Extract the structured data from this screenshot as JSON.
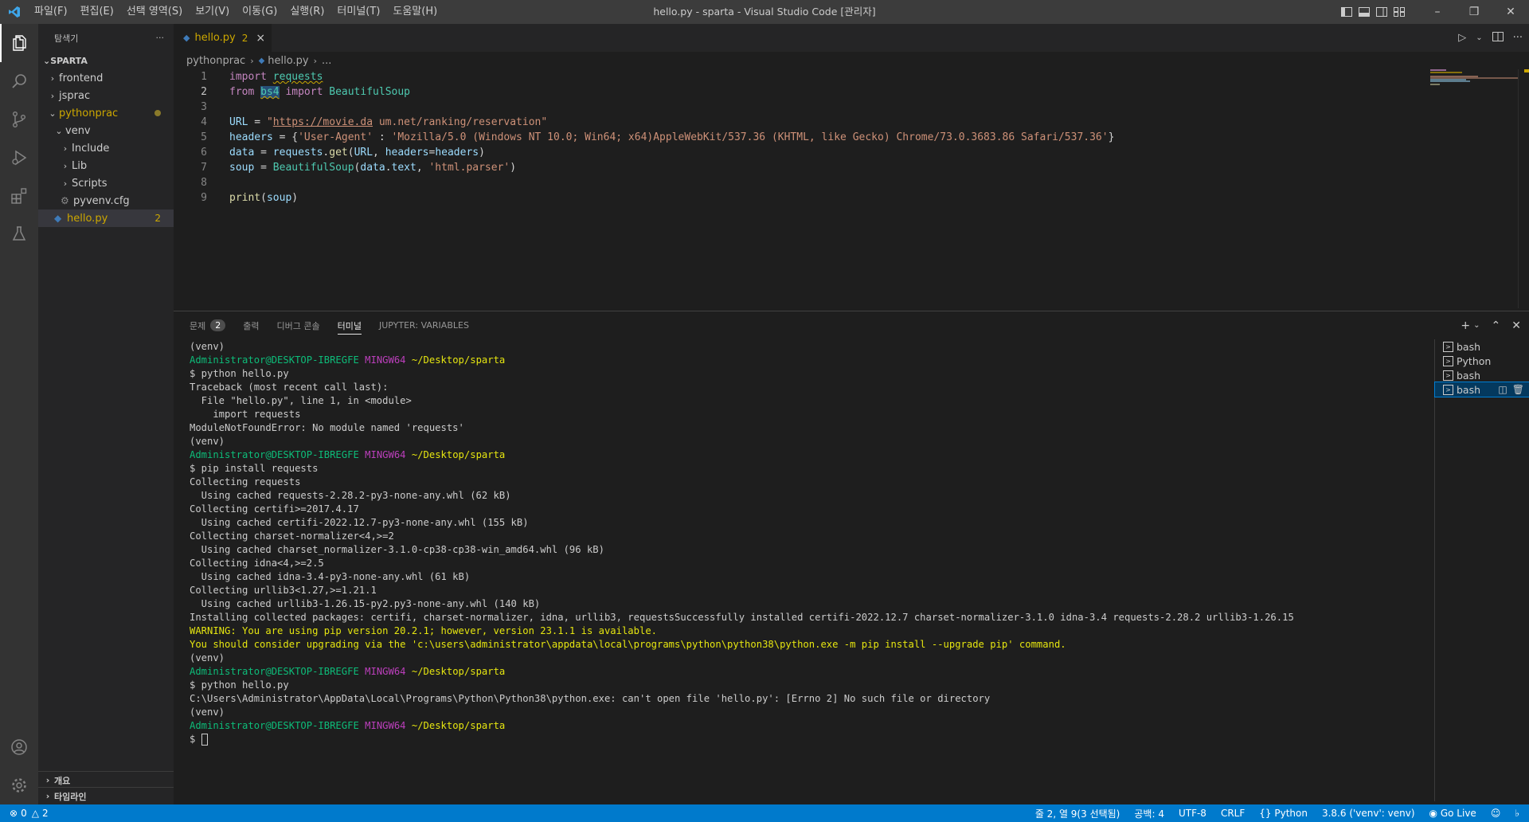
{
  "window": {
    "title": "hello.py - sparta - Visual Studio Code [관리자]",
    "menu": [
      "파일(F)",
      "편집(E)",
      "선택 영역(S)",
      "보기(V)",
      "이동(G)",
      "실행(R)",
      "터미널(T)",
      "도움말(H)"
    ]
  },
  "explorer": {
    "header": "탐색기",
    "more": "···",
    "root": "SPARTA",
    "items": [
      {
        "label": "frontend"
      },
      {
        "label": "jsprac"
      },
      {
        "label": "pythonprac"
      },
      {
        "label": "venv"
      },
      {
        "label": "Include"
      },
      {
        "label": "Lib"
      },
      {
        "label": "Scripts"
      },
      {
        "label": "pyvenv.cfg"
      },
      {
        "label": "hello.py",
        "badge": "2"
      }
    ],
    "outline": "개요",
    "timeline": "타임라인"
  },
  "editor": {
    "tab": {
      "label": "hello.py",
      "count": "2",
      "close": "×"
    },
    "breadcrumb": [
      "pythonprac",
      "hello.py",
      "..."
    ],
    "line_numbers": [
      "1",
      "2",
      "3",
      "4",
      "5",
      "6",
      "7",
      "8",
      "9"
    ]
  },
  "panel": {
    "tabs": [
      {
        "label": "문제",
        "count": "2"
      },
      {
        "label": "출력"
      },
      {
        "label": "디버그 콘솔"
      },
      {
        "label": "터미널"
      },
      {
        "label": "JUPYTER: VARIABLES"
      }
    ],
    "terminal_lines": [
      {
        "t": "(venv)"
      },
      {
        "prompt": true
      },
      {
        "t": "$ python hello.py"
      },
      {
        "t": "Traceback (most recent call last):"
      },
      {
        "t": "  File \"hello.py\", line 1, in <module>"
      },
      {
        "t": "    import requests"
      },
      {
        "t": "ModuleNotFoundError: No module named 'requests'"
      },
      {
        "t": "(venv)"
      },
      {
        "prompt": true
      },
      {
        "t": "$ pip install requests"
      },
      {
        "t": "Collecting requests"
      },
      {
        "t": "  Using cached requests-2.28.2-py3-none-any.whl (62 kB)"
      },
      {
        "t": "Collecting certifi>=2017.4.17"
      },
      {
        "t": "  Using cached certifi-2022.12.7-py3-none-any.whl (155 kB)"
      },
      {
        "t": "Collecting charset-normalizer<4,>=2"
      },
      {
        "t": "  Using cached charset_normalizer-3.1.0-cp38-cp38-win_amd64.whl (96 kB)"
      },
      {
        "t": "Collecting idna<4,>=2.5"
      },
      {
        "t": "  Using cached idna-3.4-py3-none-any.whl (61 kB)"
      },
      {
        "t": "Collecting urllib3<1.27,>=1.21.1"
      },
      {
        "t": "  Using cached urllib3-1.26.15-py2.py3-none-any.whl (140 kB)"
      },
      {
        "t": "Installing collected packages: certifi, charset-normalizer, idna, urllib3, requestsSuccessfully installed certifi-2022.12.7 charset-normalizer-3.1.0 idna-3.4 requests-2.28.2 urllib3-1.26.15"
      },
      {
        "t": "WARNING: You are using pip version 20.2.1; however, version 23.1.1 is available.",
        "warn": true
      },
      {
        "t": "You should consider upgrading via the 'c:\\users\\administrator\\appdata\\local\\programs\\python\\python38\\python.exe -m pip install --upgrade pip' command.",
        "warn": true
      },
      {
        "t": "(venv)"
      },
      {
        "prompt": true
      },
      {
        "t": "$ python hello.py"
      },
      {
        "t": "C:\\Users\\Administrator\\AppData\\Local\\Programs\\Python\\Python38\\python.exe: can't open file 'hello.py': [Errno 2] No such file or directory"
      },
      {
        "t": "(venv)"
      },
      {
        "prompt": true
      },
      {
        "t": "$ ",
        "cursor": true
      }
    ],
    "prompt": {
      "user": "Administrator@DESKTOP-IBREGFE",
      "shell": "MINGW64",
      "path": "~/Desktop/sparta"
    },
    "terminals": [
      "bash",
      "Python",
      "bash",
      "bash"
    ]
  },
  "statusbar": {
    "errors": "0",
    "warnings": "2",
    "position": "줄 2, 열 9(3 선택됨)",
    "spaces": "공백: 4",
    "encoding": "UTF-8",
    "eol": "CRLF",
    "language": "Python",
    "interpreter": "3.8.6 ('venv': venv)",
    "golive": "Go Live"
  }
}
